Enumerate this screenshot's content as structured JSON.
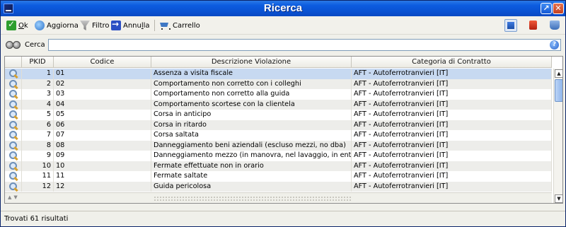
{
  "window": {
    "title": "Ricerca"
  },
  "toolbar": {
    "ok_prefix": "",
    "ok_accel": "O",
    "ok_rest": "k",
    "refresh_label": "Aggiorna",
    "filter_label": "Filtro",
    "undo_before": "Annu",
    "undo_accel": "l",
    "undo_after": "la",
    "cart_label": "Carrello"
  },
  "search": {
    "label": "Cerca",
    "value": ""
  },
  "table": {
    "columns": [
      "PKID",
      "Codice",
      "Descrizione Violazione",
      "Categoria di Contratto"
    ],
    "rows": [
      {
        "pkid": "1",
        "codice": "01",
        "descrizione": "Assenza a visita fiscale",
        "categoria": "AFT - Autoferrotranvieri [IT]"
      },
      {
        "pkid": "2",
        "codice": "02",
        "descrizione": "Comportamento non corretto con i colleghi",
        "categoria": "AFT - Autoferrotranvieri [IT]"
      },
      {
        "pkid": "3",
        "codice": "03",
        "descrizione": "Comportamento non corretto alla guida",
        "categoria": "AFT - Autoferrotranvieri [IT]"
      },
      {
        "pkid": "4",
        "codice": "04",
        "descrizione": "Comportamento scortese con la clientela",
        "categoria": "AFT - Autoferrotranvieri [IT]"
      },
      {
        "pkid": "5",
        "codice": "05",
        "descrizione": "Corsa in anticipo",
        "categoria": "AFT - Autoferrotranvieri [IT]"
      },
      {
        "pkid": "6",
        "codice": "06",
        "descrizione": "Corsa in ritardo",
        "categoria": "AFT - Autoferrotranvieri [IT]"
      },
      {
        "pkid": "7",
        "codice": "07",
        "descrizione": "Corsa saltata",
        "categoria": "AFT - Autoferrotranvieri [IT]"
      },
      {
        "pkid": "8",
        "codice": "08",
        "descrizione": "Danneggiamento beni aziendali (escluso mezzi, no dba)",
        "categoria": "AFT - Autoferrotranvieri [IT]"
      },
      {
        "pkid": "9",
        "codice": "09",
        "descrizione": "Danneggiamento mezzo (in manovra, nel lavaggio, in entrata",
        "categoria": "AFT - Autoferrotranvieri [IT]"
      },
      {
        "pkid": "10",
        "codice": "10",
        "descrizione": "Fermate effettuate non in orario",
        "categoria": "AFT - Autoferrotranvieri [IT]"
      },
      {
        "pkid": "11",
        "codice": "11",
        "descrizione": "Fermate saltate",
        "categoria": "AFT - Autoferrotranvieri [IT]"
      },
      {
        "pkid": "12",
        "codice": "12",
        "descrizione": "Guida pericolosa",
        "categoria": "AFT - Autoferrotranvieri [IT]"
      }
    ]
  },
  "status": {
    "text": "Trovati 61 risultati"
  }
}
